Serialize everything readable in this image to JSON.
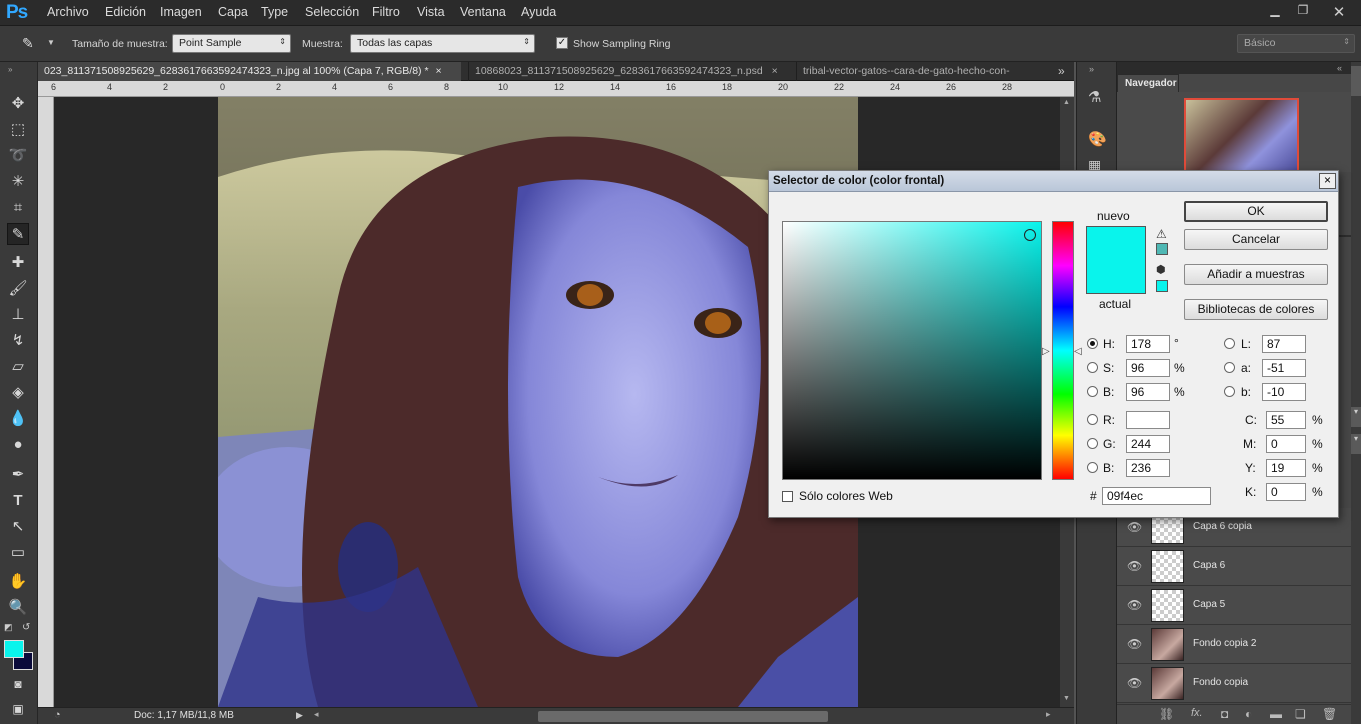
{
  "app": {
    "logo": "Ps"
  },
  "menu": [
    "Archivo",
    "Edición",
    "Imagen",
    "Capa",
    "Type",
    "Selección",
    "Filtro",
    "Vista",
    "Ventana",
    "Ayuda"
  ],
  "options": {
    "sample_size_label": "Tamaño de muestra:",
    "sample_size_value": "Point Sample",
    "sample_label": "Muestra:",
    "sample_value": "Todas las capas",
    "sampling_ring_label": "Show Sampling Ring",
    "sampling_ring_checked": true,
    "workspace_value": "Básico"
  },
  "tabs": [
    {
      "label": "023_811371508925629_6283617663592474323_n.jpg al 100% (Capa 7, RGB/8) *",
      "active": true,
      "close": "×"
    },
    {
      "label": "10868023_811371508925629_6283617663592474323_n.psd",
      "active": false,
      "close": "×"
    },
    {
      "label": "tribal-vector-gatos--cara-de-gato-hecho-con-",
      "active": false,
      "close": ""
    }
  ],
  "tabs_overflow": "»",
  "ruler_ticks": [
    "6",
    "4",
    "2",
    "0",
    "2",
    "4",
    "6",
    "8",
    "10",
    "12",
    "14",
    "16",
    "18",
    "20",
    "22",
    "24",
    "26",
    "28"
  ],
  "status": {
    "doc": "Doc: 1,17 MB/11,8 MB"
  },
  "navigator": {
    "title": "Navegador"
  },
  "layers": [
    {
      "name": "Capa 6 copia",
      "thumb": "transparent"
    },
    {
      "name": "Capa 6",
      "thumb": "transparent"
    },
    {
      "name": "Capa 5",
      "thumb": "transparent"
    },
    {
      "name": "Fondo copia 2",
      "thumb": "photo"
    },
    {
      "name": "Fondo copia",
      "thumb": "photo"
    }
  ],
  "colors": {
    "foreground": "#09f4ec",
    "background": "#0a0a3a",
    "accent": "#31a8ff"
  },
  "dialog": {
    "title": "Selector de color (color frontal)",
    "close": "×",
    "new_label": "nuevo",
    "current_label": "actual",
    "new_color": "#09f4ec",
    "current_color": "#09f4ec",
    "buttons": {
      "ok": "OK",
      "cancel": "Cancelar",
      "add_swatches": "Añadir a muestras",
      "libraries": "Bibliotecas de colores"
    },
    "hsb": [
      {
        "label": "H:",
        "value": "178",
        "unit": "°",
        "selected": true
      },
      {
        "label": "S:",
        "value": "96",
        "unit": "%",
        "selected": false
      },
      {
        "label": "B:",
        "value": "96",
        "unit": "%",
        "selected": false
      }
    ],
    "rgb": [
      {
        "label": "R:",
        "value": "",
        "selected": false
      },
      {
        "label": "G:",
        "value": "244",
        "selected": false
      },
      {
        "label": "B:",
        "value": "236",
        "selected": false
      }
    ],
    "lab": [
      {
        "label": "L:",
        "value": "87"
      },
      {
        "label": "a:",
        "value": "-51"
      },
      {
        "label": "b:",
        "value": "-10"
      }
    ],
    "cmyk": [
      {
        "label": "C:",
        "value": "55",
        "unit": "%"
      },
      {
        "label": "M:",
        "value": "0",
        "unit": "%"
      },
      {
        "label": "Y:",
        "value": "19",
        "unit": "%"
      },
      {
        "label": "K:",
        "value": "0",
        "unit": "%"
      }
    ],
    "hex_label": "#",
    "hex_value": "09f4ec",
    "web_only_label": "Sólo colores Web",
    "web_only_checked": false
  }
}
